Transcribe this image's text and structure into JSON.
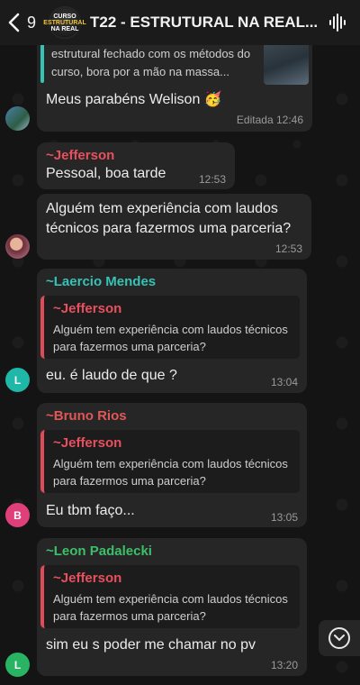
{
  "header": {
    "back_count": "9",
    "title": "T22 - ESTRUTURAL NA REAL...",
    "avatar_lines": [
      "CURSO",
      "ESTRUTURAL",
      "NA REAL"
    ]
  },
  "messages": {
    "m0": {
      "partial_text": "estrutural fechado com os métodos do curso, bora por a mão na massa...",
      "text": "Meus parabéns Welison 🥳",
      "edited": "Editada",
      "time": "12:46"
    },
    "m1": {
      "sender": "~Jefferson",
      "text": "Pessoal, boa tarde",
      "time": "12:53"
    },
    "m2": {
      "text": "Alguém tem experiência com laudos técnicos para fazermos uma parceria?",
      "time": "12:53"
    },
    "m3": {
      "sender": "~Laercio Mendes",
      "quote_sender": "~Jefferson",
      "quote_text": "Alguém tem experiência com laudos técnicos para fazermos uma parceria?",
      "text": "eu. é laudo de que ?",
      "time": "13:04",
      "avatar_letter": "L"
    },
    "m4": {
      "sender": "~Bruno Rios",
      "quote_sender": "~Jefferson",
      "quote_text": "Alguém tem experiência com laudos técnicos para fazermos uma parceria?",
      "text": "Eu tbm faço...",
      "time": "13:05",
      "avatar_letter": "B"
    },
    "m5": {
      "sender": "~Leon Padalecki",
      "quote_sender": "~Jefferson",
      "quote_text": "Alguém tem experiência com laudos técnicos para fazermos uma parceria?",
      "text": "sim eu  s poder me chamar no pv",
      "time": "13:20",
      "avatar_letter": "L"
    }
  },
  "colors": {
    "laercio": "#36c2b4",
    "bruno": "#e05757",
    "leon": "#3dbf6a",
    "jefferson": "#e8505e",
    "avatar_laercio": "#1fb7a8",
    "avatar_bruno": "#e0407a",
    "avatar_leon": "#28b463"
  }
}
